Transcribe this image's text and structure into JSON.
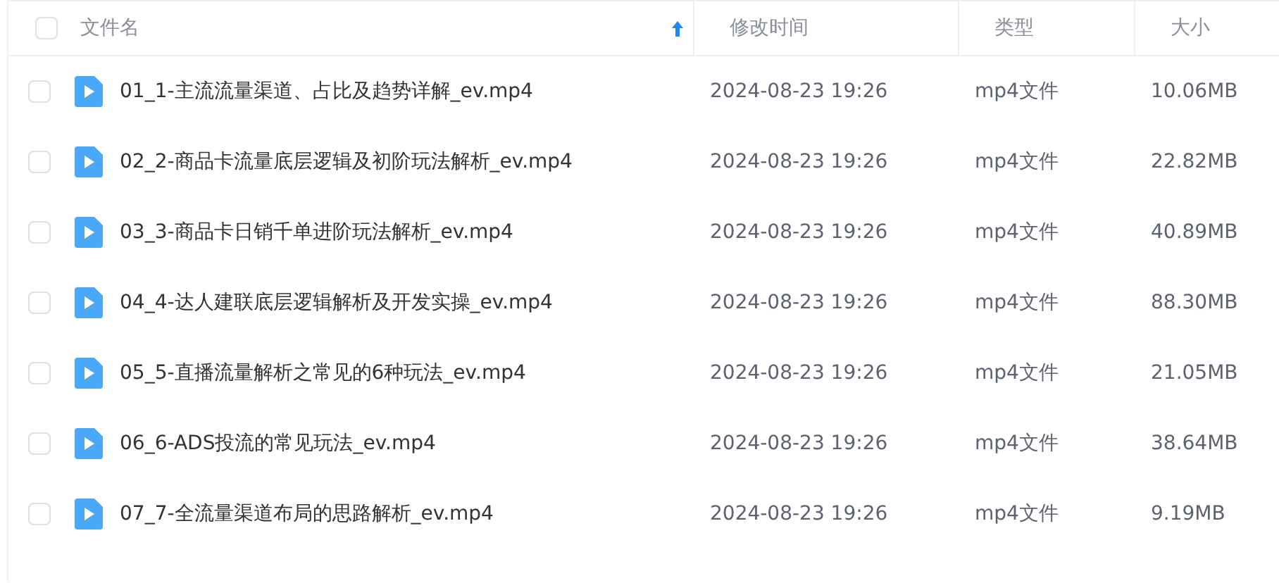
{
  "table": {
    "columns": [
      {
        "label": "文件名",
        "sorted": true
      },
      {
        "label": "修改时间",
        "sorted": false
      },
      {
        "label": "类型",
        "sorted": false
      },
      {
        "label": "大小",
        "sorted": false
      }
    ],
    "select_all": {
      "checked": false
    },
    "rows": [
      {
        "name": "01_1-主流流量渠道、占比及趋势详解_ev.mp4",
        "modified": "2024-08-23 19:26",
        "type": "mp4文件",
        "size": "10.06MB",
        "checked": false
      },
      {
        "name": "02_2-商品卡流量底层逻辑及初阶玩法解析_ev.mp4",
        "modified": "2024-08-23 19:26",
        "type": "mp4文件",
        "size": "22.82MB",
        "checked": false
      },
      {
        "name": "03_3-商品卡日销千单进阶玩法解析_ev.mp4",
        "modified": "2024-08-23 19:26",
        "type": "mp4文件",
        "size": "40.89MB",
        "checked": false
      },
      {
        "name": "04_4-达人建联底层逻辑解析及开发实操_ev.mp4",
        "modified": "2024-08-23 19:26",
        "type": "mp4文件",
        "size": "88.30MB",
        "checked": false
      },
      {
        "name": "05_5-直播流量解析之常见的6种玩法_ev.mp4",
        "modified": "2024-08-23 19:26",
        "type": "mp4文件",
        "size": "21.05MB",
        "checked": false
      },
      {
        "name": "06_6-ADS投流的常见玩法_ev.mp4",
        "modified": "2024-08-23 19:26",
        "type": "mp4文件",
        "size": "38.64MB",
        "checked": false
      },
      {
        "name": "07_7-全流量渠道布局的思路解析_ev.mp4",
        "modified": "2024-08-23 19:26",
        "type": "mp4文件",
        "size": "9.19MB",
        "checked": false
      }
    ]
  }
}
